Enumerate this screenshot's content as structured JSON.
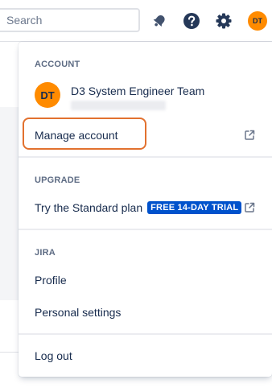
{
  "topbar": {
    "search_placeholder": "Search",
    "icons": [
      "notifications-icon",
      "help-icon",
      "settings-icon"
    ],
    "avatar_initials": "DT"
  },
  "menu": {
    "account": {
      "header": "ACCOUNT",
      "user_name": "D3 System Engineer Team",
      "avatar_initials": "DT",
      "manage_label": "Manage account"
    },
    "upgrade": {
      "header": "UPGRADE",
      "try_label": "Try the Standard plan",
      "badge": "FREE 14-DAY TRIAL"
    },
    "jira": {
      "header": "JIRA",
      "profile_label": "Profile",
      "settings_label": "Personal settings"
    },
    "logout_label": "Log out"
  },
  "colors": {
    "accent": "#0052cc",
    "avatar": "#ff8b00",
    "highlight": "#e2712f",
    "text": "#172b4d",
    "subtle": "#5e6c84"
  }
}
